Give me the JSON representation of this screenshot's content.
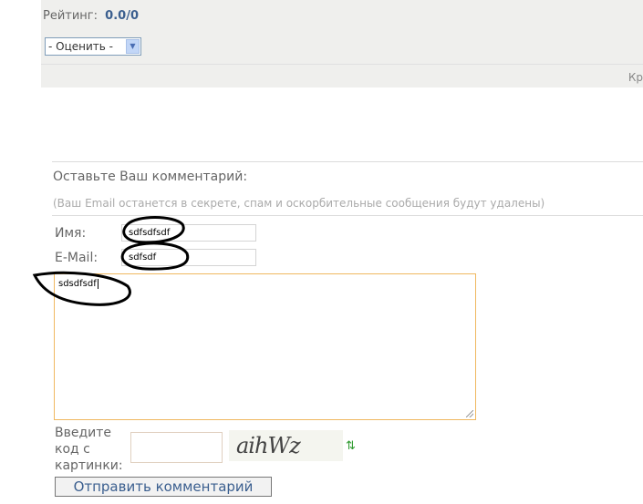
{
  "rating": {
    "label": "Рейтинг:",
    "value": "0.0/0",
    "select_value": "- Оценить -",
    "cut_text": "Кр"
  },
  "comment_form": {
    "title": "Оставьте Ваш комментарий:",
    "note": "(Ваш Email останется в секрете, спам и оскорбительные сообщения будут удалены)",
    "name_label": "Имя:",
    "name_value": "sdfsdfsdf",
    "email_label": "E-Mail:",
    "email_value": "sdfsdf",
    "comment_value": "sdsdfsdf",
    "captcha_label": "Введите код с картинки:",
    "captcha_text": "aihWz",
    "submit_label": "Отправить комментарий"
  },
  "colors": {
    "panel_bg": "#efefed",
    "accent_link": "#3b5f8f",
    "textarea_focus": "#f0b860",
    "refresh": "#2e9a2e"
  }
}
